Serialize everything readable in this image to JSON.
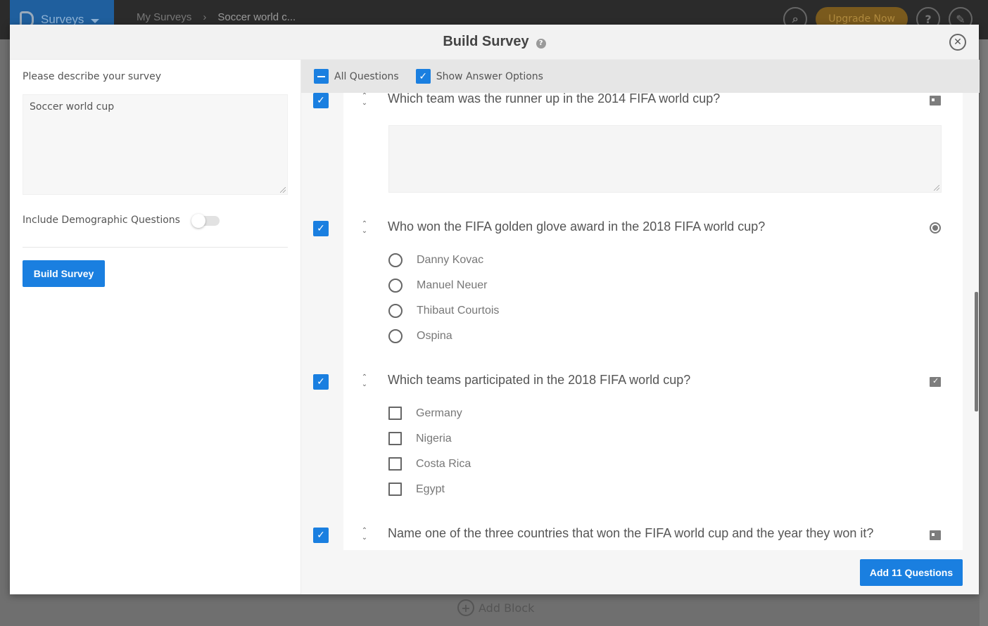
{
  "app": {
    "brand": "Surveys",
    "breadcrumbs": [
      "My Surveys",
      "Soccer world c..."
    ],
    "upgrade_label": "Upgrade Now",
    "add_block_label": "Add Block"
  },
  "modal": {
    "title": "Build Survey",
    "left": {
      "describe_label": "Please describe your survey",
      "describe_value": "Soccer world cup",
      "demographic_label": "Include Demographic Questions",
      "demographic_enabled": false,
      "build_button": "Build Survey"
    },
    "toolbar": {
      "all_questions": "All Questions",
      "show_answer_options": "Show Answer Options"
    },
    "questions": [
      {
        "text": "Which team was the runner up in the 2014 FIFA world cup?",
        "type_icon": "comment-box-icon",
        "checked": true,
        "options": []
      },
      {
        "text": "Who won the FIFA golden glove award in the 2018 FIFA world cup?",
        "type_icon": "radio-icon",
        "checked": true,
        "options": [
          "Danny Kovac",
          "Manuel Neuer",
          "Thibaut Courtois",
          "Ospina"
        ]
      },
      {
        "text": "Which teams participated in the 2018 FIFA world cup?",
        "type_icon": "multi-select-icon",
        "checked": true,
        "options": [
          "Germany",
          "Nigeria",
          "Costa Rica",
          "Egypt"
        ]
      },
      {
        "text": "Name one of the three countries that won the FIFA world cup and the year they won it?",
        "type_icon": "comment-box-icon",
        "checked": true,
        "options": []
      }
    ],
    "add_button": "Add 11 Questions"
  }
}
